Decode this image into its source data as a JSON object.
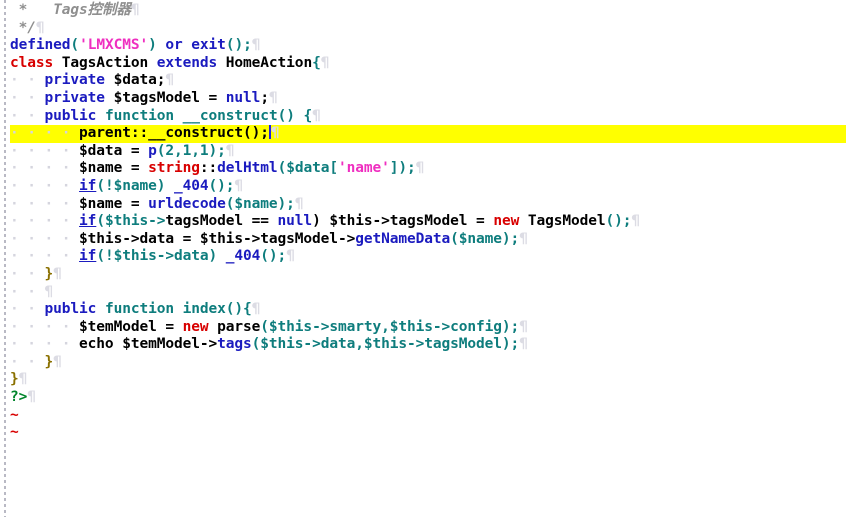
{
  "app": {
    "kind": "terminal-text-editor",
    "name": "vim",
    "background": "#ffffff",
    "cursorline_color": "#ffff00",
    "cursor_color": "#2222dd"
  },
  "colors": {
    "comment": "#8f8f8f",
    "keyword": "#1b1bbf",
    "statement": "#d80000",
    "function": "#0e7d7d",
    "string": "#ef2fc0",
    "identifier": "#1b1bbf",
    "punctuation": "#0e7d7d",
    "brace": "#8a7000",
    "php_tag": "#00852b",
    "eol_mark": "#dcdce4",
    "whitespace_dot": "#d5d5de",
    "tilde": "#d80000"
  },
  "marks": {
    "eol": "¶",
    "lead_dot": "·",
    "tilde": "~"
  },
  "cursor": {
    "line_index": 6,
    "line_text": "        parent::__construct();",
    "column_after": ";"
  },
  "lines": [
    {
      "n": 1,
      "text": " *   Tags控制器",
      "tokens": [
        {
          "t": " ",
          "c": "plain"
        },
        {
          "t": "*   Tags控制器",
          "c": "comment"
        }
      ],
      "eol": true
    },
    {
      "n": 2,
      "text": " */",
      "tokens": [
        {
          "t": " ",
          "c": "plain"
        },
        {
          "t": "*/",
          "c": "comment"
        }
      ],
      "eol": true
    },
    {
      "n": 3,
      "text": "defined('LMXCMS') or exit();",
      "tokens": [
        {
          "t": "defined",
          "c": "keyword"
        },
        {
          "t": "(",
          "c": "punct"
        },
        {
          "t": "'LMXCMS'",
          "c": "string"
        },
        {
          "t": ")",
          "c": "punct"
        },
        {
          "t": " or ",
          "c": "keyword"
        },
        {
          "t": "exit",
          "c": "keyword"
        },
        {
          "t": "();",
          "c": "punct"
        }
      ],
      "eol": true
    },
    {
      "n": 4,
      "text": "class TagsAction extends HomeAction{",
      "tokens": [
        {
          "t": "class",
          "c": "statement"
        },
        {
          "t": " TagsAction ",
          "c": "plain"
        },
        {
          "t": "extends",
          "c": "keyword"
        },
        {
          "t": " HomeAction",
          "c": "plain"
        },
        {
          "t": "{",
          "c": "punct"
        }
      ],
      "eol": true
    },
    {
      "n": 5,
      "text": "    private $data;",
      "indent": 4,
      "tokens": [
        {
          "t": "private",
          "c": "keyword"
        },
        {
          "t": " $data;",
          "c": "plain"
        }
      ],
      "eol": true
    },
    {
      "n": 6,
      "text": "    private $tagsModel = null;",
      "indent": 4,
      "tokens": [
        {
          "t": "private",
          "c": "keyword"
        },
        {
          "t": " $tagsModel = ",
          "c": "plain"
        },
        {
          "t": "null",
          "c": "keyword"
        },
        {
          "t": ";",
          "c": "plain"
        }
      ],
      "eol": true
    },
    {
      "n": 7,
      "text": "    public function __construct() {",
      "indent": 4,
      "tokens": [
        {
          "t": "public",
          "c": "keyword"
        },
        {
          "t": " ",
          "c": "plain"
        },
        {
          "t": "function",
          "c": "function"
        },
        {
          "t": " ",
          "c": "plain"
        },
        {
          "t": "__construct",
          "c": "function"
        },
        {
          "t": "() {",
          "c": "punct"
        }
      ],
      "eol": true
    },
    {
      "n": 8,
      "text": "        parent::__construct();",
      "indent": 8,
      "highlight": true,
      "tokens": [
        {
          "t": "parent",
          "c": "plain"
        },
        {
          "t": "::",
          "c": "plain"
        },
        {
          "t": "__construct",
          "c": "plain"
        },
        {
          "t": "();",
          "c": "plain"
        }
      ],
      "eol": true
    },
    {
      "n": 9,
      "text": "        $data = p(2,1,1);",
      "indent": 8,
      "tokens": [
        {
          "t": "$data = ",
          "c": "plain"
        },
        {
          "t": "p",
          "c": "identifier"
        },
        {
          "t": "(2,1,1);",
          "c": "punct"
        }
      ],
      "eol": true
    },
    {
      "n": 10,
      "text": "        $name = string::delHtml($data['name']);",
      "indent": 8,
      "tokens": [
        {
          "t": "$name = ",
          "c": "plain"
        },
        {
          "t": "string",
          "c": "statement"
        },
        {
          "t": "::",
          "c": "plain"
        },
        {
          "t": "delHtml",
          "c": "identifier"
        },
        {
          "t": "($data[",
          "c": "punct"
        },
        {
          "t": "'name'",
          "c": "string"
        },
        {
          "t": "]);",
          "c": "punct"
        }
      ],
      "eol": true
    },
    {
      "n": 11,
      "text": "        if(!$name) _404();",
      "indent": 8,
      "tokens": [
        {
          "t": "if",
          "c": "keyword-u"
        },
        {
          "t": "(!$name) ",
          "c": "punct"
        },
        {
          "t": "_404",
          "c": "identifier"
        },
        {
          "t": "();",
          "c": "punct"
        }
      ],
      "eol": true
    },
    {
      "n": 12,
      "text": "        $name = urldecode($name);",
      "indent": 8,
      "tokens": [
        {
          "t": "$name = ",
          "c": "plain"
        },
        {
          "t": "urldecode",
          "c": "identifier"
        },
        {
          "t": "($name);",
          "c": "punct"
        }
      ],
      "eol": true
    },
    {
      "n": 13,
      "text": "        if($this->tagsModel == null) $this->tagsModel = new TagsModel();",
      "indent": 8,
      "tokens": [
        {
          "t": "if",
          "c": "keyword-u"
        },
        {
          "t": "($this",
          "c": "punct"
        },
        {
          "t": "->",
          "c": "punct"
        },
        {
          "t": "tagsModel == ",
          "c": "plain"
        },
        {
          "t": "null",
          "c": "keyword"
        },
        {
          "t": ") $this->tagsModel = ",
          "c": "plain"
        },
        {
          "t": "new",
          "c": "statement"
        },
        {
          "t": " TagsModel",
          "c": "plain"
        },
        {
          "t": "();",
          "c": "punct"
        }
      ],
      "eol": true
    },
    {
      "n": 14,
      "text": "        $this->data = $this->tagsModel->getNameData($name);",
      "indent": 8,
      "tokens": [
        {
          "t": "$this->data = $this->tagsModel->",
          "c": "plain"
        },
        {
          "t": "getNameData",
          "c": "identifier"
        },
        {
          "t": "($name);",
          "c": "punct"
        }
      ],
      "eol": true
    },
    {
      "n": 15,
      "text": "        if(!$this->data) _404();",
      "indent": 8,
      "tokens": [
        {
          "t": "if",
          "c": "keyword-u"
        },
        {
          "t": "(!$this->data) ",
          "c": "punct"
        },
        {
          "t": "_404",
          "c": "identifier"
        },
        {
          "t": "();",
          "c": "punct"
        }
      ],
      "eol": true
    },
    {
      "n": 16,
      "text": "    }",
      "indent": 4,
      "tokens": [
        {
          "t": "}",
          "c": "brace"
        }
      ],
      "eol": true
    },
    {
      "n": 17,
      "text": "    ",
      "indent": 4,
      "tokens": [],
      "eol": true
    },
    {
      "n": 18,
      "text": "    public function index(){",
      "indent": 4,
      "tokens": [
        {
          "t": "public",
          "c": "keyword"
        },
        {
          "t": " ",
          "c": "plain"
        },
        {
          "t": "function",
          "c": "function"
        },
        {
          "t": " ",
          "c": "plain"
        },
        {
          "t": "index",
          "c": "function"
        },
        {
          "t": "(){",
          "c": "punct"
        }
      ],
      "eol": true
    },
    {
      "n": 19,
      "text": "        $temModel = new parse($this->smarty,$this->config);",
      "indent": 8,
      "tokens": [
        {
          "t": "$temModel = ",
          "c": "plain"
        },
        {
          "t": "new",
          "c": "statement"
        },
        {
          "t": " parse",
          "c": "plain"
        },
        {
          "t": "($this",
          "c": "punct"
        },
        {
          "t": "->",
          "c": "punct"
        },
        {
          "t": "smarty,$this->config);",
          "c": "punct"
        }
      ],
      "eol": true
    },
    {
      "n": 20,
      "text": "        echo $temModel->tags($this->data,$this->tagsModel);",
      "indent": 8,
      "tokens": [
        {
          "t": "echo $temModel->",
          "c": "plain"
        },
        {
          "t": "tags",
          "c": "identifier"
        },
        {
          "t": "($this->data,$this->tagsModel);",
          "c": "punct"
        }
      ],
      "eol": true
    },
    {
      "n": 21,
      "text": "    }",
      "indent": 4,
      "tokens": [
        {
          "t": "}",
          "c": "brace"
        }
      ],
      "eol": true
    },
    {
      "n": 22,
      "text": "}",
      "tokens": [
        {
          "t": "}",
          "c": "brace"
        }
      ],
      "eol": true
    },
    {
      "n": 23,
      "text": "?>",
      "tokens": [
        {
          "t": "?>",
          "c": "php"
        }
      ],
      "eol": true
    },
    {
      "n": 24,
      "text": "~",
      "tilde": true,
      "tokens": [],
      "eol": false
    },
    {
      "n": 25,
      "text": "~",
      "tilde": true,
      "tokens": [],
      "eol": false
    }
  ]
}
